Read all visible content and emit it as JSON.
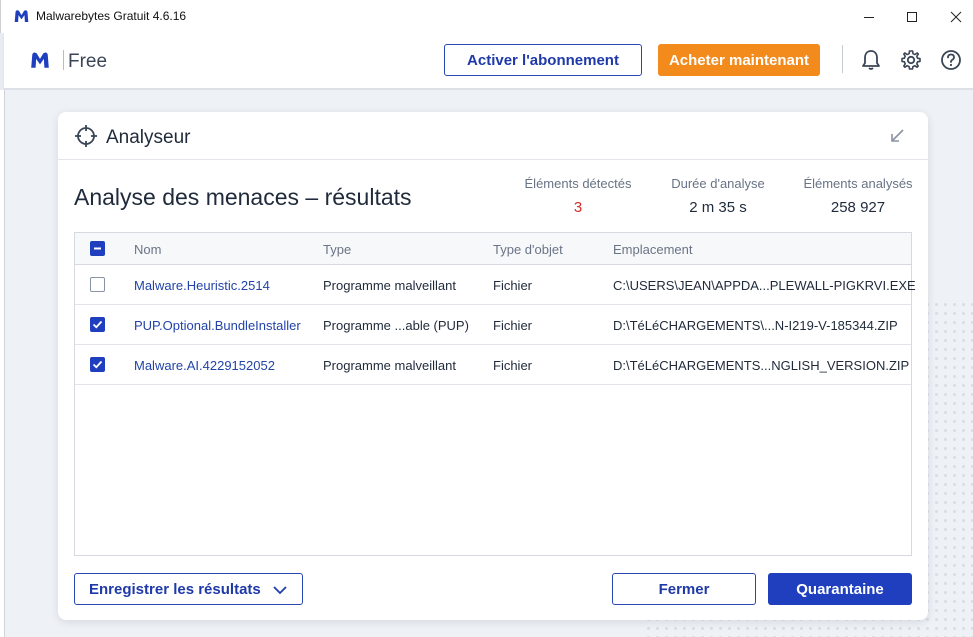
{
  "window": {
    "title": "Malwarebytes Gratuit 4.6.16"
  },
  "header": {
    "plan": "Free",
    "activate_label": "Activer l'abonnement",
    "buy_label": "Acheter maintenant",
    "accent_color": "#1f3fbf",
    "buy_color": "#f28a1c"
  },
  "panel": {
    "title": "Analyseur",
    "results_title": "Analyse des menaces – résultats",
    "stats": {
      "detected_label": "Éléments détectés",
      "detected_value": "3",
      "duration_label": "Durée d'analyse",
      "duration_value": "2 m 35 s",
      "scanned_label": "Éléments analysés",
      "scanned_value": "258 927"
    },
    "table": {
      "headers": {
        "name": "Nom",
        "type": "Type",
        "object_type": "Type d'objet",
        "location": "Emplacement"
      },
      "rows": [
        {
          "checked": false,
          "name": "Malware.Heuristic.2514",
          "type": "Programme malveillant",
          "object_type": "Fichier",
          "location": "C:\\USERS\\JEAN\\APPDA...PLEWALL-PIGKRVI.EXE"
        },
        {
          "checked": true,
          "name": "PUP.Optional.BundleInstaller",
          "type": "Programme ...able (PUP)",
          "object_type": "Fichier",
          "location": "D:\\TéLéCHARGEMENTS\\...N-I219-V-185344.ZIP"
        },
        {
          "checked": true,
          "name": "Malware.AI.4229152052",
          "type": "Programme malveillant",
          "object_type": "Fichier",
          "location": "D:\\TéLéCHARGEMENTS...NGLISH_VERSION.ZIP"
        }
      ]
    },
    "buttons": {
      "save": "Enregistrer les résultats",
      "close": "Fermer",
      "quarantine": "Quarantaine"
    }
  }
}
